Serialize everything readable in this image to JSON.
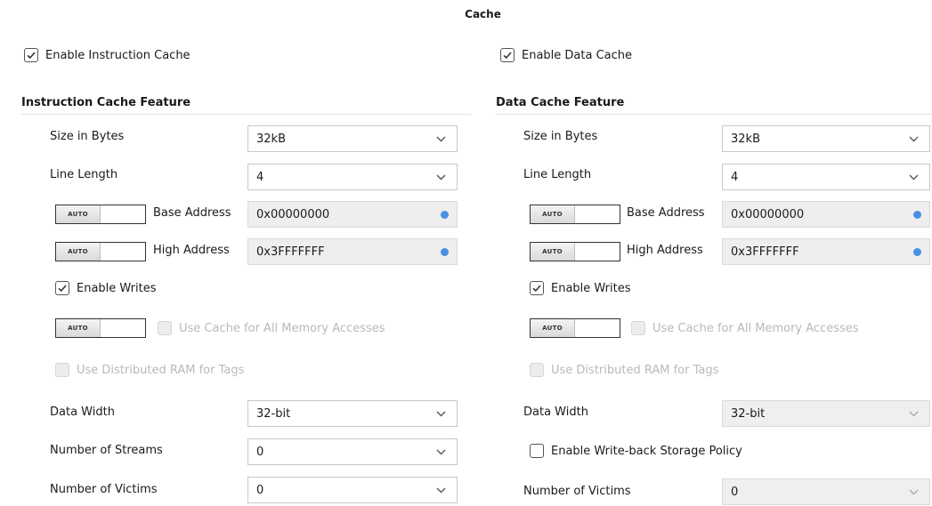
{
  "page": {
    "title": "Cache"
  },
  "icache": {
    "enable_label": "Enable Instruction Cache",
    "enable_checked": true,
    "section_title": "Instruction Cache Feature",
    "size": {
      "label": "Size in Bytes",
      "value": "32kB"
    },
    "line_length": {
      "label": "Line Length",
      "value": "4"
    },
    "base": {
      "toggle_label": "AUTO",
      "label": "Base Address",
      "value": "0x00000000"
    },
    "high": {
      "toggle_label": "AUTO",
      "label": "High Address",
      "value": "0x3FFFFFFF"
    },
    "enable_writes": {
      "label": "Enable Writes",
      "checked": true
    },
    "use_cache_all": {
      "toggle_label": "AUTO",
      "label": "Use Cache for All Memory Accesses",
      "enabled": false
    },
    "distributed_ram": {
      "label": "Use Distributed RAM for Tags",
      "enabled": false
    },
    "data_width": {
      "label": "Data Width",
      "value": "32-bit"
    },
    "streams": {
      "label": "Number of Streams",
      "value": "0"
    },
    "victims": {
      "label": "Number of Victims",
      "value": "0"
    }
  },
  "dcache": {
    "enable_label": "Enable Data Cache",
    "enable_checked": true,
    "section_title": "Data Cache Feature",
    "size": {
      "label": "Size in Bytes",
      "value": "32kB"
    },
    "line_length": {
      "label": "Line Length",
      "value": "4"
    },
    "base": {
      "toggle_label": "AUTO",
      "label": "Base Address",
      "value": "0x00000000"
    },
    "high": {
      "toggle_label": "AUTO",
      "label": "High Address",
      "value": "0x3FFFFFFF"
    },
    "enable_writes": {
      "label": "Enable Writes",
      "checked": true
    },
    "use_cache_all": {
      "toggle_label": "AUTO",
      "label": "Use Cache for All Memory Accesses",
      "enabled": false
    },
    "distributed_ram": {
      "label": "Use Distributed RAM for Tags",
      "enabled": false
    },
    "data_width": {
      "label": "Data Width",
      "value": "32-bit",
      "enabled": false
    },
    "writeback": {
      "label": "Enable Write-back Storage Policy",
      "checked": false
    },
    "victims": {
      "label": "Number of Victims",
      "value": "0",
      "enabled": false
    }
  },
  "colors": {
    "info_icon": "#2b7fe0",
    "disabled_text": "#b9b9b9",
    "border": "#c8c8c8"
  }
}
